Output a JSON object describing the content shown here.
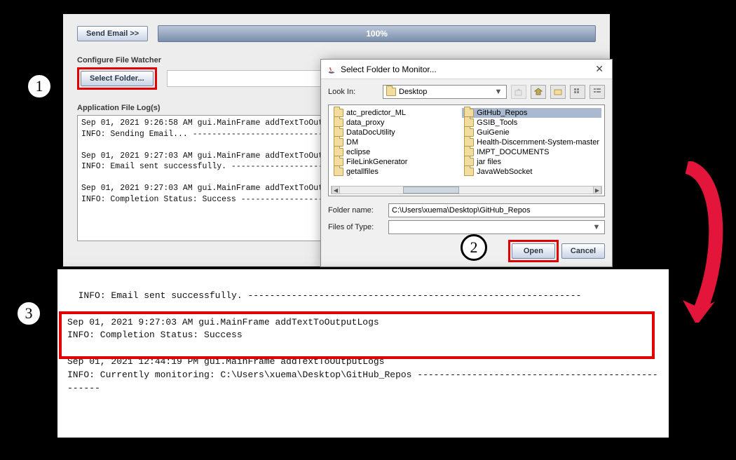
{
  "main": {
    "send_email_label": "Send Email >>",
    "progress_label": "100%",
    "configure_label": "Configure File Watcher",
    "select_folder_label": "Select Folder...",
    "app_log_label": "Application File Log(s)",
    "log_text": "Sep 01, 2021 9:26:58 AM gui.MainFrame addTextToOutputLogs\nINFO: Sending Email... --------------------------------------------------------------------\n\nSep 01, 2021 9:27:03 AM gui.MainFrame addTextToOutputLogs\nINFO: Email sent successfully. -------------------------------------------------------------\n\nSep 01, 2021 9:27:03 AM gui.MainFrame addTextToOutputLogs\nINFO: Completion Status: Success ----------------------------------------------------------"
  },
  "dialog": {
    "title": "Select Folder to Monitor...",
    "lookin_label": "Look In:",
    "lookin_value": "Desktop",
    "foldername_label": "Folder name:",
    "foldername_value": "C:\\Users\\xuema\\Desktop\\GitHub_Repos",
    "filetype_label": "Files of Type:",
    "open_label": "Open",
    "cancel_label": "Cancel",
    "items_left": [
      "atc_predictor_ML",
      "data_proxy",
      "DataDocUtility",
      "DM",
      "eclipse",
      "FileLinkGenerator",
      "getallfiles"
    ],
    "items_right": [
      "GitHub_Repos",
      "GSIB_Tools",
      "GuiGenie",
      "Health-Discernment-System-master",
      "IMPT_DOCUMENTS",
      "jar files",
      "JavaWebSocket"
    ],
    "selected_index": 0
  },
  "bottom_log": {
    "text": "INFO: Email sent successfully. -------------------------------------------------------------\n\nSep 01, 2021 9:27:03 AM gui.MainFrame addTextToOutputLogs\nINFO: Completion Status: Success\n\nSep 01, 2021 12:44:19 PM gui.MainFrame addTextToOutputLogs\nINFO: Currently monitoring: C:\\Users\\xuema\\Desktop\\GitHub_Repos --------------------------------------------------"
  },
  "callouts": {
    "c1": "1",
    "c2": "2",
    "c3": "3"
  },
  "colors": {
    "highlight_red": "#e00000",
    "arrow": "#e4153b"
  }
}
